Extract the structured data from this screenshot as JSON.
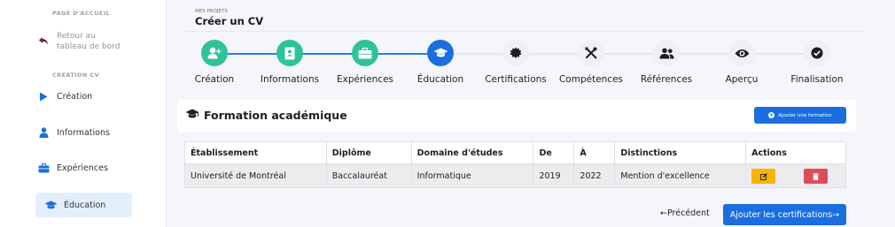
{
  "sidebar": {
    "section1": "PAGE D'ACCUEIL",
    "back": "Retour au tableau de bord",
    "section2": "CRÉATION CV",
    "items": [
      {
        "label": "Création",
        "icon": "play-icon"
      },
      {
        "label": "Informations",
        "icon": "user-icon"
      },
      {
        "label": "Expériences",
        "icon": "briefcase-icon"
      },
      {
        "label": "Éducation",
        "icon": "graduation-cap-icon"
      }
    ]
  },
  "header": {
    "breadcrumb": "MES PROJETS",
    "title": "Créer un CV"
  },
  "stepper": {
    "steps": [
      {
        "label": "Création",
        "icon": "user-plus-icon",
        "state": "done"
      },
      {
        "label": "Informations",
        "icon": "id-card-icon",
        "state": "done"
      },
      {
        "label": "Expériences",
        "icon": "briefcase-icon",
        "state": "done"
      },
      {
        "label": "Éducation",
        "icon": "graduation-cap-icon",
        "state": "active"
      },
      {
        "label": "Certifications",
        "icon": "certificate-icon",
        "state": "todo"
      },
      {
        "label": "Compétences",
        "icon": "tools-icon",
        "state": "todo"
      },
      {
        "label": "Références",
        "icon": "users-icon",
        "state": "todo"
      },
      {
        "label": "Aperçu",
        "icon": "eye-icon",
        "state": "todo"
      },
      {
        "label": "Finalisation",
        "icon": "check-circle-icon",
        "state": "todo"
      }
    ],
    "colors": {
      "done": "#2fc39a",
      "active": "#1a6ee0",
      "todo": "#eef0f3"
    }
  },
  "section": {
    "title": "Formation académique",
    "add_button": "Ajouter une formation"
  },
  "table": {
    "headers": [
      "Établissement",
      "Diplôme",
      "Domaine d'études",
      "De",
      "À",
      "Distinctions",
      "Actions"
    ],
    "rows": [
      [
        "Université de Montréal",
        "Baccalauréat",
        "Informatique",
        "2019",
        "2022",
        "Mention d'excellence"
      ]
    ]
  },
  "footer": {
    "prev": "←Précédent",
    "next": "Ajouter les certifications→"
  }
}
